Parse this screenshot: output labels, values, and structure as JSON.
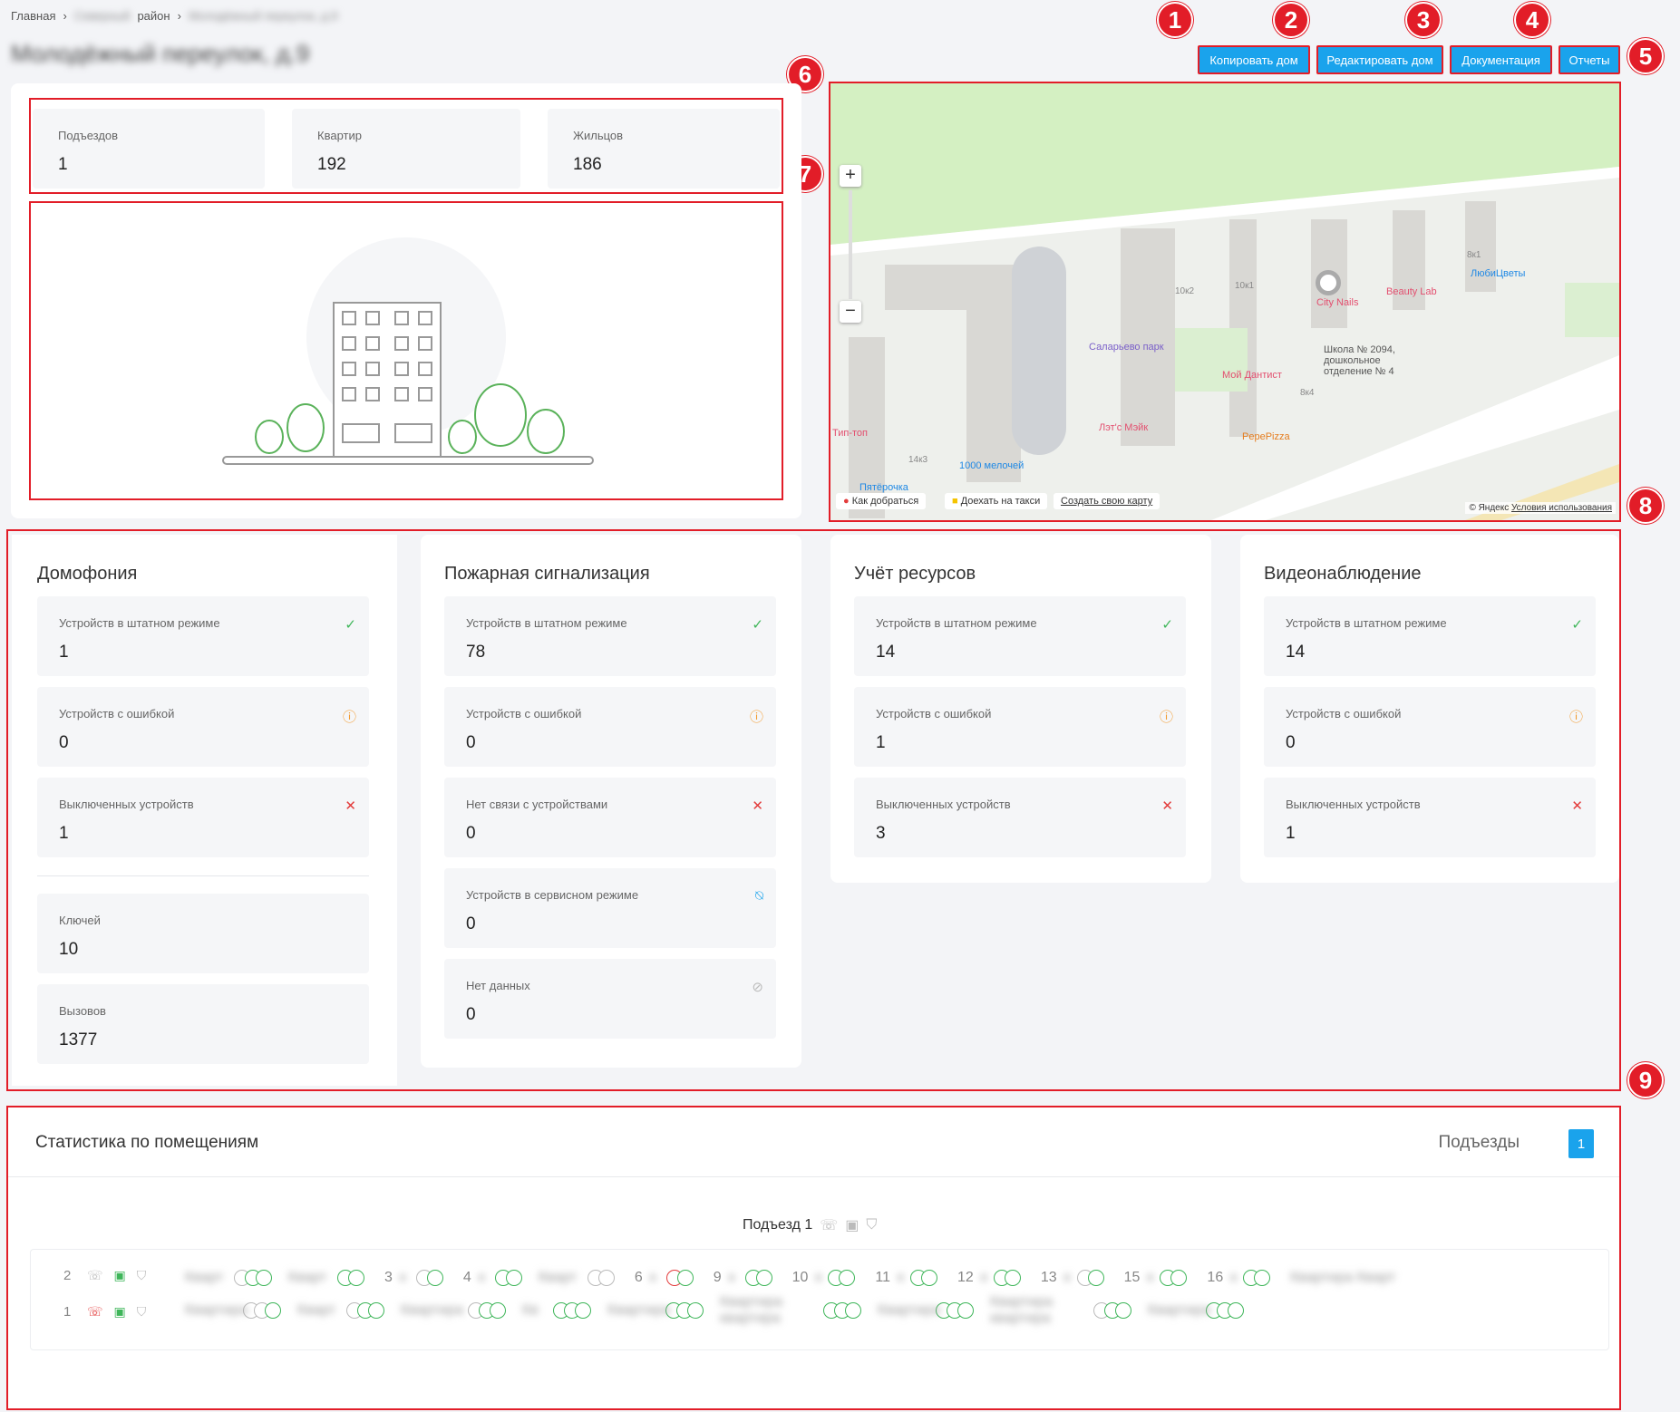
{
  "breadcrumb": {
    "home": "Главная",
    "district_blurred": "Северный",
    "district_suffix": "район",
    "current_blurred": "Молодёжный переулок, д.9"
  },
  "page_title": "Молодёжный переулок, д.9",
  "actions": {
    "copy_label": "Копировать дом",
    "edit_label": "Редактировать дом",
    "docs_label": "Документация",
    "reports_label": "Отчеты"
  },
  "callouts": [
    "1",
    "2",
    "3",
    "4",
    "5",
    "6",
    "7",
    "8",
    "9"
  ],
  "summary": {
    "entrances_label": "Подъездов",
    "entrances_value": "1",
    "apartments_label": "Квартир",
    "apartments_value": "192",
    "residents_label": "Жильцов",
    "residents_value": "186"
  },
  "map": {
    "zoom_in": "+",
    "zoom_out": "−",
    "labels": {
      "salarevo": "Саларьево парк",
      "city_nails": "City Nails",
      "beauty_lab": "Beauty Lab",
      "lyubitsvety": "ЛюбиЦветы",
      "school": "Школа № 2094, дошкольное отделение № 4",
      "dentist": "Мой Дантист",
      "lets_make": "Лэт'с Мэйк",
      "pepe": "PepePizza",
      "tip_top": "Тип-топ",
      "melochei": "1000 мелочей",
      "pyaterochka": "Пятёрочка",
      "b10k2": "10к2",
      "b10k1": "10к1",
      "b8k1": "8к1",
      "b8k4": "8к4",
      "b14k3": "14к3"
    },
    "route": "Как добраться",
    "taxi": "Доехать на такси",
    "create": "Создать свою карту",
    "copyright": "© Яндекс",
    "terms": "Условия использования"
  },
  "sections": {
    "intercom": {
      "title": "Домофония",
      "normal_label": "Устройств в штатном режиме",
      "normal_value": "1",
      "error_label": "Устройств с ошибкой",
      "error_value": "0",
      "off_label": "Выключенных устройств",
      "off_value": "1",
      "keys_label": "Ключей",
      "keys_value": "10",
      "calls_label": "Вызовов",
      "calls_value": "1377"
    },
    "fire": {
      "title": "Пожарная сигнализация",
      "normal_label": "Устройств в штатном режиме",
      "normal_value": "78",
      "error_label": "Устройств с ошибкой",
      "error_value": "0",
      "noconn_label": "Нет связи с устройствами",
      "noconn_value": "0",
      "service_label": "Устройств в сервисном режиме",
      "service_value": "0",
      "nodata_label": "Нет данных",
      "nodata_value": "0"
    },
    "resources": {
      "title": "Учёт ресурсов",
      "normal_label": "Устройств в штатном режиме",
      "normal_value": "14",
      "error_label": "Устройств с ошибкой",
      "error_value": "1",
      "off_label": "Выключенных устройств",
      "off_value": "3"
    },
    "video": {
      "title": "Видеонаблюдение",
      "normal_label": "Устройств в штатном режиме",
      "normal_value": "14",
      "error_label": "Устройств с ошибкой",
      "error_value": "0",
      "off_label": "Выключенных устройств",
      "off_value": "1"
    }
  },
  "rooms": {
    "title": "Статистика по помещениям",
    "entrances_label": "Подъезды",
    "entrance_badge": "1",
    "entrance_heading": "Подъезд 1",
    "floor2": "2",
    "floor1": "1",
    "floor2_numbers": [
      "3",
      "4",
      "6",
      "9",
      "10",
      "11",
      "12",
      "13",
      "15",
      "16"
    ]
  }
}
